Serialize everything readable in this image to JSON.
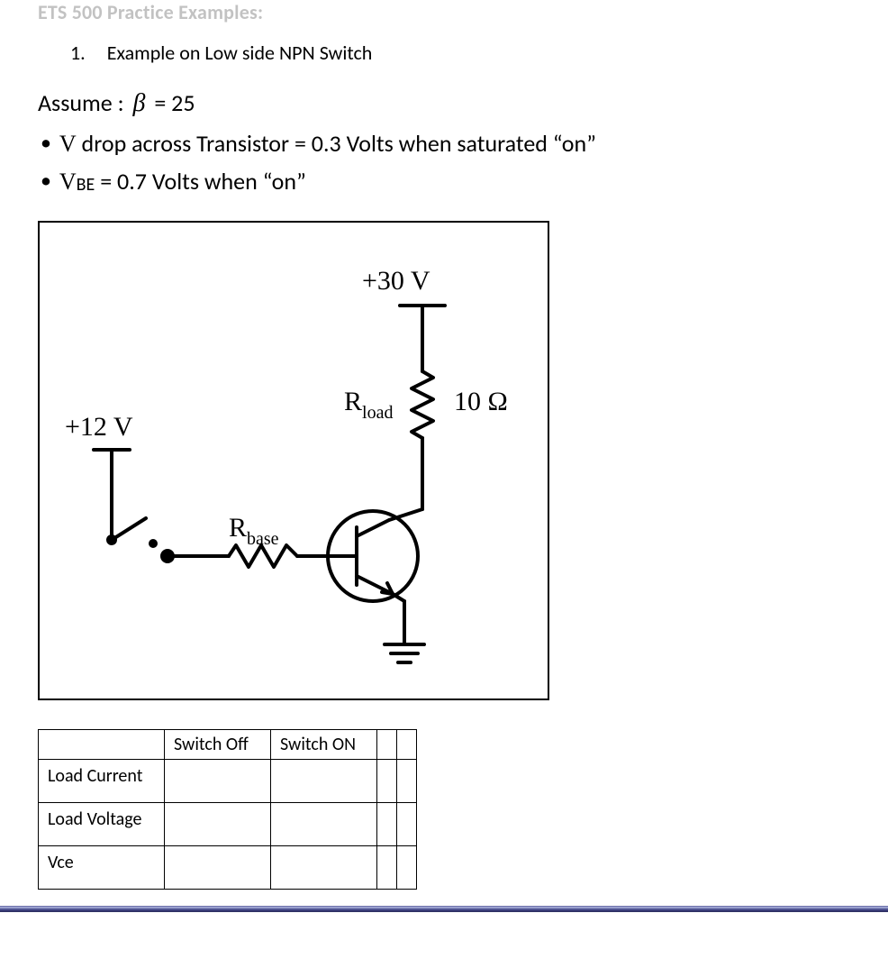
{
  "header_faded": "ETS 500 Practice Examples:",
  "example": {
    "number": "1.",
    "title": "Example on Low side NPN Switch"
  },
  "assume_label": "Assume :",
  "beta_symbol": "β",
  "beta_value": "= 25",
  "bullets": {
    "b1_prefix": "V",
    "b1_rest": " drop across Transistor = 0.3 Volts when saturated “on”",
    "b2_prefix": "V",
    "b2_sub": "BE",
    "b2_rest": " = 0.7 Volts when “on”"
  },
  "circuit": {
    "v_supply_load": "+30 V",
    "v_supply_ctrl": "+12 V",
    "r_load_name": "R",
    "r_load_sub": "load",
    "r_load_value": "10 Ω",
    "r_base_name": "R",
    "r_base_sub": "base"
  },
  "table": {
    "col_off": "Switch Off",
    "col_on": "Switch ON",
    "rows": [
      "Load Current",
      "Load Voltage",
      "Vce"
    ]
  }
}
